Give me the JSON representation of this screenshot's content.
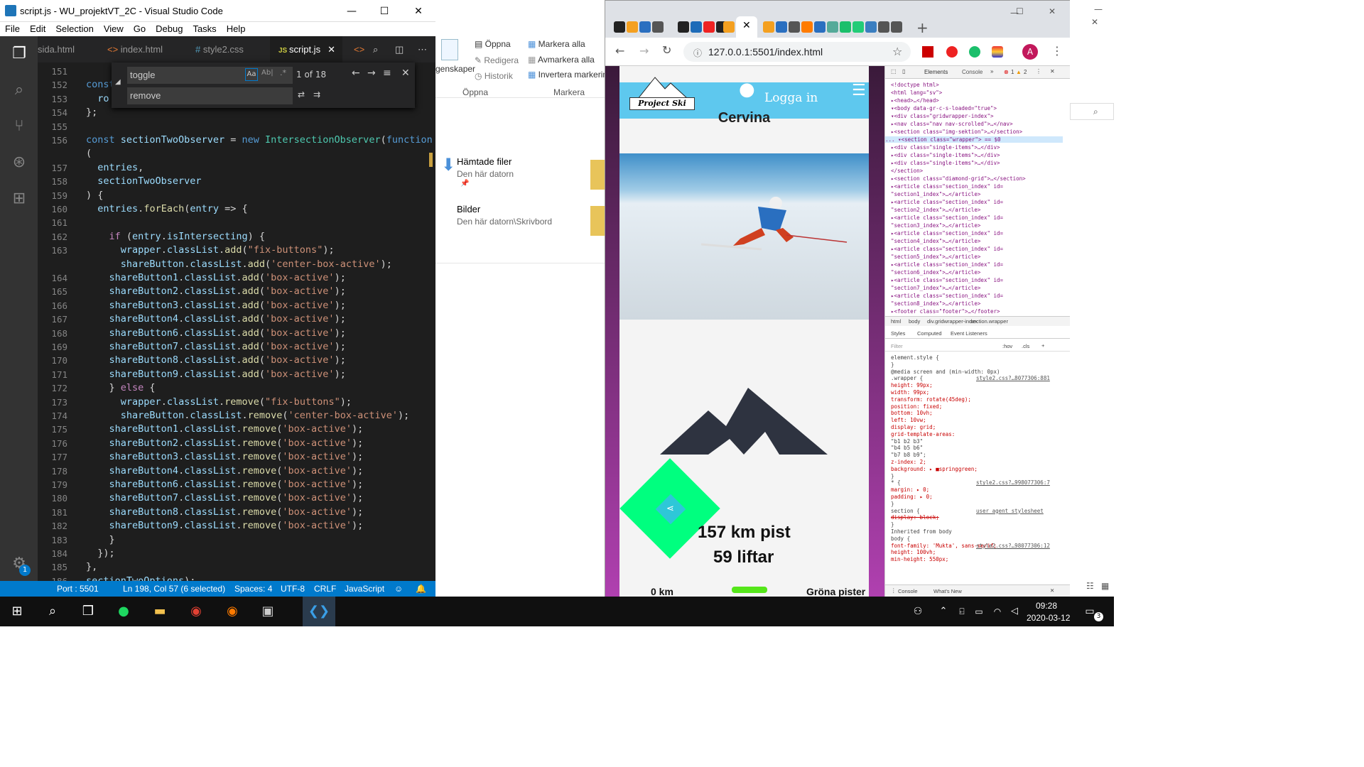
{
  "vscode": {
    "title": "script.js - WU_projektVT_2C - Visual Studio Code",
    "menu": [
      "File",
      "Edit",
      "Selection",
      "View",
      "Go",
      "Debug",
      "Tasks",
      "Help"
    ],
    "tabs": [
      "sida.html",
      "index.html",
      "style2.css",
      "script.js"
    ],
    "find": {
      "query": "toggle",
      "replace": "remove",
      "count": "1 of 18"
    },
    "lines": [
      {
        "n": "151",
        "t": ""
      },
      {
        "n": "152",
        "t": "const"
      },
      {
        "n": "153",
        "t": "  ro"
      },
      {
        "n": "154",
        "t": "};"
      },
      {
        "n": "155",
        "t": ""
      },
      {
        "n": "156",
        "t": "const sectionTwoObserver = new IntersectionObserver(function"
      },
      {
        "n": "",
        "t": "("
      },
      {
        "n": "157",
        "t": "  entries,"
      },
      {
        "n": "158",
        "t": "  sectionTwoObserver"
      },
      {
        "n": "159",
        "t": ") {"
      },
      {
        "n": "160",
        "t": "  entries.forEach(entry => {"
      },
      {
        "n": "161",
        "t": ""
      },
      {
        "n": "162",
        "t": "    if (entry.isIntersecting) {"
      },
      {
        "n": "163",
        "t": "      wrapper.classList.add(\"fix-buttons\");"
      },
      {
        "n": "",
        "t": "      shareButton.classList.add('center-box-active');"
      },
      {
        "n": "164",
        "t": "    shareButton1.classList.add('box-active');"
      },
      {
        "n": "165",
        "t": "    shareButton2.classList.add('box-active');"
      },
      {
        "n": "166",
        "t": "    shareButton3.classList.add('box-active');"
      },
      {
        "n": "167",
        "t": "    shareButton4.classList.add('box-active');"
      },
      {
        "n": "168",
        "t": "    shareButton6.classList.add('box-active');"
      },
      {
        "n": "169",
        "t": "    shareButton7.classList.add('box-active');"
      },
      {
        "n": "170",
        "t": "    shareButton8.classList.add('box-active');"
      },
      {
        "n": "171",
        "t": "    shareButton9.classList.add('box-active');"
      },
      {
        "n": "172",
        "t": "    } else {"
      },
      {
        "n": "173",
        "t": "      wrapper.classList.remove(\"fix-buttons\");"
      },
      {
        "n": "174",
        "t": "      shareButton.classList.remove('center-box-active');"
      },
      {
        "n": "175",
        "t": "    shareButton1.classList.remove('box-active');"
      },
      {
        "n": "176",
        "t": "    shareButton2.classList.remove('box-active');"
      },
      {
        "n": "177",
        "t": "    shareButton3.classList.remove('box-active');"
      },
      {
        "n": "178",
        "t": "    shareButton4.classList.remove('box-active');"
      },
      {
        "n": "179",
        "t": "    shareButton6.classList.remove('box-active');"
      },
      {
        "n": "180",
        "t": "    shareButton7.classList.remove('box-active');"
      },
      {
        "n": "181",
        "t": "    shareButton8.classList.remove('box-active');"
      },
      {
        "n": "182",
        "t": "    shareButton9.classList.remove('box-active');"
      },
      {
        "n": "183",
        "t": "    }"
      },
      {
        "n": "184",
        "t": "  });"
      },
      {
        "n": "185",
        "t": "},"
      },
      {
        "n": "186",
        "t": "sectionTwoOptions);"
      }
    ],
    "status": {
      "port": "Port : 5501",
      "pos": "Ln 198, Col 57 (6 selected)",
      "spaces": "Spaces: 4",
      "enc": "UTF-8",
      "eol": "CRLF",
      "lang": "JavaScript",
      "badge": "1"
    }
  },
  "explorer": {
    "open": "Öppna",
    "edit": "Redigera",
    "history": "Historik",
    "select_all": "Markera alla",
    "deselect_all": "Avmarkera alla",
    "invert": "Invertera markering",
    "group_open": "Öppna",
    "group_select": "Markera",
    "props": "genskaper",
    "items": [
      {
        "name": "Hämtade filer",
        "sub": "Den här datorn"
      },
      {
        "name": "Bilder",
        "sub": "Den här datorn\\Skrivbord"
      }
    ]
  },
  "chrome": {
    "url": "127.0.0.1:5501/index.html",
    "avatar": "A"
  },
  "site": {
    "logo": "Project Ski",
    "login": "Logga in",
    "title": "Cervina",
    "pist": "157 km pist",
    "lifts": "59 liftar",
    "km": "0 km",
    "green": "Gröna pister"
  },
  "devtools": {
    "tabs": [
      "Elements",
      "Console"
    ],
    "errors": "1",
    "warnings": "2",
    "crumbs": [
      "html",
      "body",
      "div.gridwrapper-index",
      "section.wrapper"
    ],
    "style_tabs": [
      "Styles",
      "Computed",
      "Event Listeners"
    ],
    "filter": "Filter",
    "hov": ":hov",
    ".cls": ".cls",
    "bottom": [
      "Console",
      "What's New"
    ],
    "dom": [
      "<!doctype html>",
      "<html lang=\"sv\">",
      "▸<head>…</head>",
      "▾<body data-gr-c-s-loaded=\"true\">",
      "  ▾<div class=\"gridwrapper-index\">",
      "    ▸<nav class=\"nav nav-scrolled\">…</nav>",
      "    ▸<section class=\"img-sektion\">…</section>",
      "... ▾<section class=\"wrapper\"> == $0",
      "      ▸<div class=\"single-items\">…</div>",
      "      ▸<div class=\"single-items\">…</div>",
      "      ▸<div class=\"single-items\">…</div>",
      "     </section>",
      "    ▸<section class=\"diamond-grid\">…</section>",
      "    ▸<article class=\"section_index\" id=",
      "    \"section1_index\">…</article>",
      "    ▸<article class=\"section_index\" id=",
      "    \"section2_index\">…</article>",
      "    ▸<article class=\"section_index\" id=",
      "    \"section3_index\">…</article>",
      "    ▸<article class=\"section_index\" id=",
      "    \"section4_index\">…</article>",
      "    ▸<article class=\"section_index\" id=",
      "    \"section5_index\">…</article>",
      "    ▸<article class=\"section_index\" id=",
      "    \"section6_index\">…</article>",
      "    ▸<article class=\"section_index\" id=",
      "    \"section7_index\">…</article>",
      "    ▸<article class=\"section_index\" id=",
      "    \"section8_index\">…</article>",
      "    ▸<footer class=\"footer\">…</footer>"
    ],
    "css": [
      "element.style {",
      "}",
      "@media screen and (min-width: 0px)",
      ".wrapper {",
      "  height: 99px;",
      "  width: 99px;",
      "  transform: rotate(45deg);",
      "  position: fixed;",
      "  bottom: 10vh;",
      "  left: 10vw;",
      "  display: grid;",
      "  grid-template-areas:",
      "    \"b1 b2 b3\"",
      "    \"b4 b5 b6\"",
      "    \"b7 b8 b9\";",
      "  z-index: 2;",
      "  background: ▸ ■springgreen;",
      "}",
      "* {",
      "  margin: ▸ 0;",
      "  padding: ▸ 0;",
      "}",
      "section {",
      "  display: block;",
      "}",
      "Inherited from body",
      "body {",
      "  font-family: 'Mukta', sans-serif;",
      "  height: 100vh;",
      "  min-height: 550px;"
    ],
    "css_src": [
      "style2.css?…8077306:881",
      "style2.css?…998077306:7",
      "user agent stylesheet",
      "style2.css?…98077306:12"
    ]
  },
  "taskbar": {
    "time": "09:28",
    "date": "2020-03-12",
    "notif": "3"
  }
}
